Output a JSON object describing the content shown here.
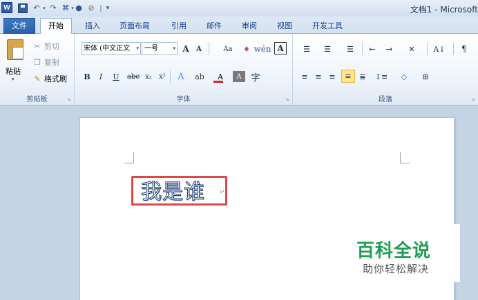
{
  "quick_access": {
    "word_logo": "W",
    "undo": "↶",
    "redo": "↷",
    "format": "⌘",
    "color": "●",
    "clear": "⊘",
    "customize": "▾"
  },
  "window": {
    "title": "文档1 - Microsoft"
  },
  "tabs": {
    "file": "文件",
    "home": "开始",
    "insert": "插入",
    "layout": "页面布局",
    "references": "引用",
    "mailings": "邮件",
    "review": "审阅",
    "view": "视图",
    "developer": "开发工具"
  },
  "clipboard": {
    "paste": "粘贴",
    "cut": "剪切",
    "copy": "复制",
    "format_painter": "格式刷",
    "group_label": "剪贴板"
  },
  "font": {
    "name": "宋体 (中文正文",
    "size": "一号",
    "grow": "A",
    "shrink": "A",
    "change_case": "Aa",
    "clear_format": "♦",
    "phonetic": "wén",
    "char_border": "A",
    "bold": "B",
    "italic": "I",
    "underline": "U",
    "strike": "abc",
    "subscript": "x₂",
    "superscript": "x²",
    "text_effect": "A",
    "highlight": "ab",
    "font_color": "A",
    "char_shading": "A",
    "enclosed": "字",
    "group_label": "字体"
  },
  "paragraph": {
    "bullets": "☰",
    "numbering": "☰",
    "multilevel": "☰",
    "dec_indent": "⇤",
    "inc_indent": "⇥",
    "chinese_layout": "✕",
    "sort": "A↓",
    "show_marks": "¶",
    "align_left": "≡",
    "align_center": "≡",
    "align_right": "≡",
    "justify": "≡",
    "distribute": "≣",
    "line_spacing": "↕≡",
    "shading": "◇",
    "borders": "⊞",
    "group_label": "段落"
  },
  "document": {
    "text": "我是谁",
    "paragraph_mark": "↵"
  },
  "watermark": {
    "title": "百科全说",
    "subtitle": "助你轻松解决"
  },
  "colors": {
    "file_tab": "#2a61ae",
    "highlight_box": "#e04646",
    "watermark_green": "#1e9e55"
  }
}
